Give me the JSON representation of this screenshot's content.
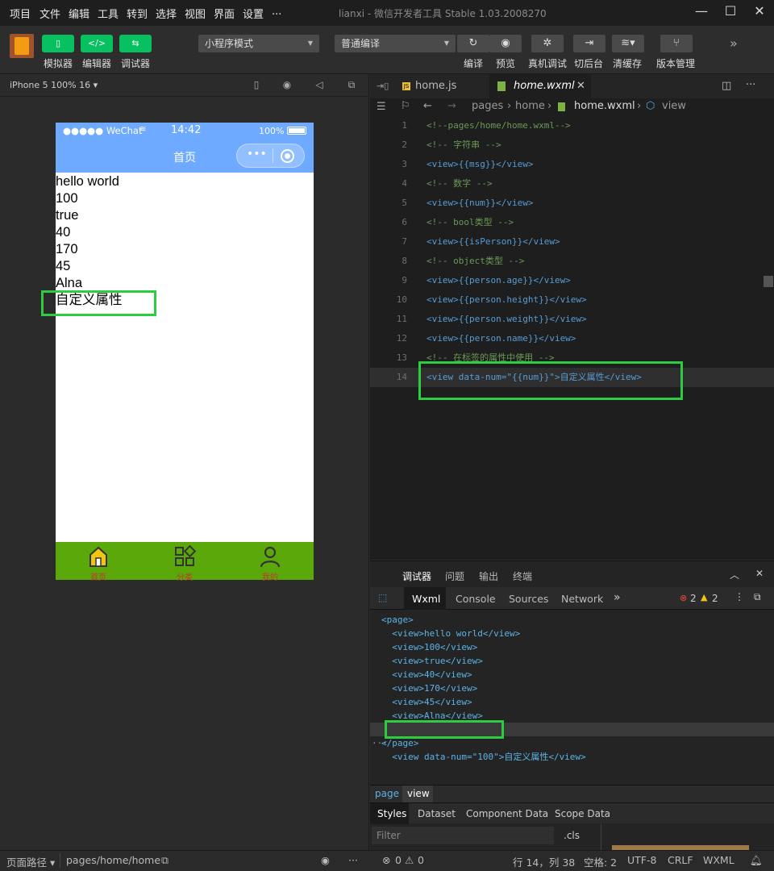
{
  "menu": [
    "项目",
    "文件",
    "编辑",
    "工具",
    "转到",
    "选择",
    "视图",
    "界面",
    "设置",
    "..."
  ],
  "window_title": "lianxi - 微信开发者工具 Stable 1.03.2008270",
  "toolbar": {
    "simulator": "模拟器",
    "editor": "编辑器",
    "debugger": "调试器",
    "mode_select": "小程序模式",
    "compile_select": "普通编译",
    "compile": "编译",
    "preview": "预览",
    "remote_debug": "真机调试",
    "background": "切后台",
    "clear_cache": "清缓存",
    "version": "版本管理"
  },
  "simulator": {
    "device": "iPhone 5 100% 16",
    "status": {
      "carrier": "●●●●● WeChat",
      "time": "14:42",
      "battery": "100%"
    },
    "nav_title": "首页",
    "lines": [
      "hello world",
      "100",
      "true",
      "40",
      "170",
      "45",
      "Alna",
      "自定义属性"
    ],
    "tabs": [
      "首页",
      "分类",
      "我的"
    ]
  },
  "editor": {
    "tabs": [
      "home.js",
      "home.wxml"
    ],
    "breadcrumb": [
      "pages",
      "home",
      "home.wxml",
      "view"
    ],
    "code": [
      "<!--pages/home/home.wxml-->",
      "<!-- 字符串 -->",
      "<view>{{msg}}</view>",
      "<!-- 数字 -->",
      "<view>{{num}}</view>",
      "<!-- bool类型 -->",
      "<view>{{isPerson}}</view>",
      "<!-- object类型 -->",
      "<view>{{person.age}}</view>",
      "<view>{{person.height}}</view>",
      "<view>{{person.weight}}</view>",
      "<view>{{person.name}}</view>",
      "<!-- 在标签的属性中使用 -->",
      "<view data-num=\"{{num}}\">自定义属性</view>"
    ],
    "line_numbers": [
      "1",
      "2",
      "3",
      "4",
      "5",
      "6",
      "7",
      "8",
      "9",
      "10",
      "11",
      "12",
      "13",
      "14"
    ]
  },
  "debugger": {
    "panel_tabs": [
      "调试器",
      "问题",
      "输出",
      "终端"
    ],
    "devtools_tabs": [
      "Wxml",
      "Console",
      "Sources",
      "Network"
    ],
    "errors": "2",
    "warnings": "2",
    "dom": [
      "<page>",
      "  <view>hello world</view>",
      "  <view>100</view>",
      "  <view>true</view>",
      "  <view>40</view>",
      "  <view>170</view>",
      "  <view>45</view>",
      "  <view>Alna</view>",
      "  <view data-num=\"100\">自定义属性</view>",
      "</page>"
    ],
    "crumbs": [
      "page",
      "view"
    ],
    "style_tabs": [
      "Styles",
      "Dataset",
      "Component Data",
      "Scope Data"
    ],
    "filter_placeholder": "Filter",
    "cls": ".cls"
  },
  "status": {
    "page_path_label": "页面路径",
    "page_path": "pages/home/home",
    "errors": "0",
    "warnings": "0",
    "position": "行 14，列 38",
    "spaces": "空格: 2",
    "encoding": "UTF-8",
    "eol": "CRLF",
    "lang": "WXML"
  }
}
